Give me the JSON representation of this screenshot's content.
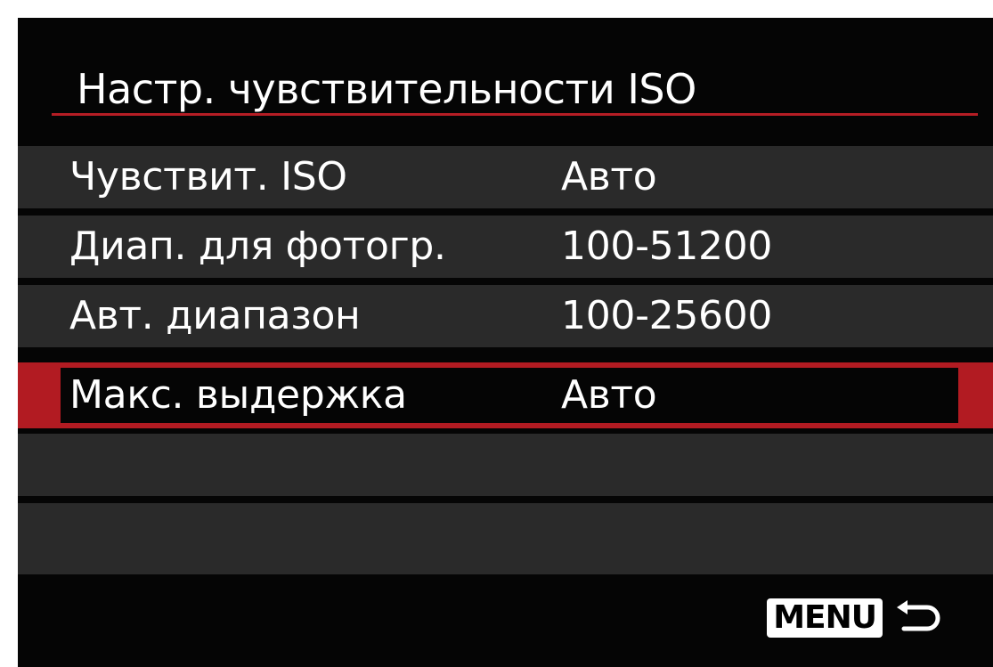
{
  "menu": {
    "title": "Настр. чувствительности ISO",
    "items": [
      {
        "label": "Чувствит. ISO",
        "value": "Авто"
      },
      {
        "label": "Диап. для фотогр.",
        "value": "100-51200"
      },
      {
        "label": "Авт. диапазон",
        "value": "100-25600"
      },
      {
        "label": "Макс. выдержка",
        "value": "Авто",
        "selected": true
      }
    ]
  },
  "footer": {
    "menu_label": "MENU",
    "back_icon": "return-arrow-icon"
  },
  "colors": {
    "background": "#050505",
    "row": "#2a2a2a",
    "accent": "#b21b22",
    "text": "#ffffff"
  }
}
